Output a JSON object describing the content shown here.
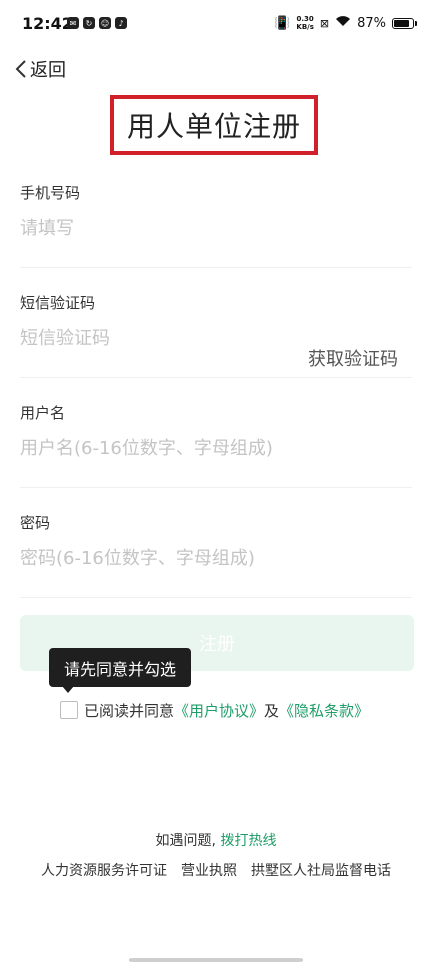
{
  "status_bar": {
    "time": "12:42",
    "net_speed_value": "0.30",
    "net_speed_unit": "KB/s",
    "battery_percent": "87%",
    "battery_level": 0.87
  },
  "nav": {
    "back_label": "返回"
  },
  "page": {
    "title": "用人单位注册"
  },
  "form": {
    "phone": {
      "label": "手机号码",
      "placeholder": "请填写",
      "value": ""
    },
    "sms": {
      "label": "短信验证码",
      "placeholder": "短信验证码",
      "value": "",
      "get_code_label": "获取验证码"
    },
    "username": {
      "label": "用户名",
      "placeholder": "用户名(6-16位数字、字母组成)",
      "value": ""
    },
    "password": {
      "label": "密码",
      "placeholder": "密码(6-16位数字、字母组成)",
      "value": ""
    },
    "submit_label": "注册"
  },
  "tooltip": {
    "text": "请先同意并勾选"
  },
  "agreement": {
    "prefix": "已阅读并同意",
    "user_agreement": "《用户协议》",
    "and": "及",
    "privacy_policy": "《隐私条款》",
    "checked": false
  },
  "help": {
    "prefix": "如遇问题,",
    "hotline": "拨打热线"
  },
  "footer": {
    "license": "人力资源服务许可证",
    "business_license": "营业执照",
    "supervision_phone": "拱墅区人社局监督电话"
  },
  "colors": {
    "accent_green": "#1e9e68",
    "title_border": "#d0202a",
    "button_disabled_bg": "#e9f5ef"
  }
}
